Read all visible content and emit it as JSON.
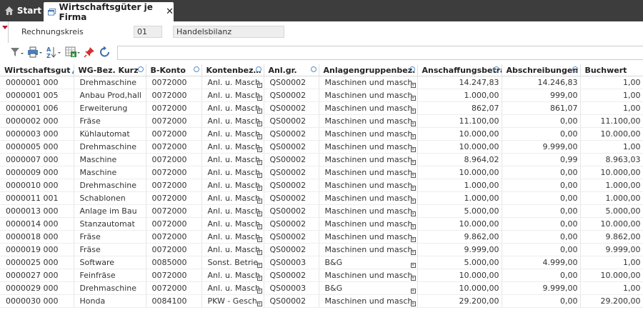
{
  "tabs": {
    "start": "Start",
    "active": "Wirtschaftsgüter je Firma",
    "close": "✕"
  },
  "filters": {
    "rechnungskreis_label": "Rechnungskreis",
    "rechnungskreis_value": "01",
    "bilanz_value": "Handelsbilanz"
  },
  "search": {
    "placeholder": ""
  },
  "columns": [
    "Wirtschaftsgut",
    "WG-Bez. Kurz",
    "B-Konto",
    "Kontenbez…",
    "Anl.gr.",
    "Anlagengruppenbez.",
    "Anschaffungsbetrag",
    "Abschreibungen",
    "Buchwert"
  ],
  "rows": [
    [
      "0000001 000",
      "Drehmaschine",
      "0072000",
      "Anl. u. Masch",
      "QS00002",
      "Maschinen und masch.",
      "14.247,83",
      "14.246,83",
      "1,00"
    ],
    [
      "0000001 005",
      "Anbau Prod,hall",
      "0072000",
      "Anl. u. Masch",
      "QS00002",
      "Maschinen und masch.",
      "1.000,00",
      "999,00",
      "1,00"
    ],
    [
      "0000001 006",
      "Erweiterung",
      "0072000",
      "Anl. u. Masch",
      "QS00002",
      "Maschinen und masch.",
      "862,07",
      "861,07",
      "1,00"
    ],
    [
      "0000002 000",
      "Fräse",
      "0072000",
      "Anl. u. Masch",
      "QS00002",
      "Maschinen und masch.",
      "11.100,00",
      "0,00",
      "11.100,00"
    ],
    [
      "0000003 000",
      "Kühlautomat",
      "0072000",
      "Anl. u. Masch",
      "QS00002",
      "Maschinen und masch.",
      "10.000,00",
      "0,00",
      "10.000,00"
    ],
    [
      "0000005 000",
      "Drehmaschine",
      "0072000",
      "Anl. u. Masch",
      "QS00002",
      "Maschinen und masch.",
      "10.000,00",
      "9.999,00",
      "1,00"
    ],
    [
      "0000007 000",
      "Maschine",
      "0072000",
      "Anl. u. Masch",
      "QS00002",
      "Maschinen und masch.",
      "8.964,02",
      "0,99",
      "8.963,03"
    ],
    [
      "0000009 000",
      "Maschine",
      "0072000",
      "Anl. u. Masch",
      "QS00002",
      "Maschinen und masch.",
      "10.000,00",
      "0,00",
      "10.000,00"
    ],
    [
      "0000010 000",
      "Drehmaschine",
      "0072000",
      "Anl. u. Masch",
      "QS00002",
      "Maschinen und masch.",
      "1.000,00",
      "0,00",
      "1.000,00"
    ],
    [
      "0000011 001",
      "Schablonen",
      "0072000",
      "Anl. u. Masch",
      "QS00002",
      "Maschinen und masch.",
      "1.000,00",
      "0,00",
      "1.000,00"
    ],
    [
      "0000013 000",
      "Anlage im Bau",
      "0072000",
      "Anl. u. Masch",
      "QS00002",
      "Maschinen und masch.",
      "5.000,00",
      "0,00",
      "5.000,00"
    ],
    [
      "0000014 000",
      "Stanzautomat",
      "0072000",
      "Anl. u. Masch",
      "QS00002",
      "Maschinen und masch.",
      "10.000,00",
      "0,00",
      "10.000,00"
    ],
    [
      "0000018 000",
      "Fräse",
      "0072000",
      "Anl. u. Masch",
      "QS00002",
      "Maschinen und masch.",
      "9.862,00",
      "0,00",
      "9.862,00"
    ],
    [
      "0000019 000",
      "Fräse",
      "0072000",
      "Anl. u. Masch",
      "QS00002",
      "Maschinen und masch.",
      "9.999,00",
      "0,00",
      "9.999,00"
    ],
    [
      "0000025 000",
      "Software",
      "0085000",
      "Sonst. Betrie",
      "QS00003",
      "B&G",
      "5.000,00",
      "4.999,00",
      "1,00"
    ],
    [
      "0000027 000",
      "Feinfräse",
      "0072000",
      "Anl. u. Masch",
      "QS00002",
      "Maschinen und masch.",
      "10.000,00",
      "0,00",
      "10.000,00"
    ],
    [
      "0000029 000",
      "Drehmaschine",
      "0072000",
      "Anl. u. Masch",
      "QS00003",
      "B&G",
      "10.000,00",
      "9.999,00",
      "1,00"
    ],
    [
      "0000030 000",
      "Honda",
      "0084100",
      "PKW - Gesch",
      "QS00002",
      "Maschinen und masch.",
      "29.200,00",
      "0,00",
      "29.200,00"
    ]
  ],
  "icons": {
    "home": "home-icon",
    "window": "window-icon",
    "filter": "filter-icon",
    "print": "print-icon",
    "sort": "sort-az-icon",
    "export": "excel-export-icon",
    "pin": "pin-icon",
    "refresh": "refresh-icon"
  },
  "colors": {
    "topbar": "#3d3d3d",
    "accent": "#3a7bc8",
    "marker": "#c0102a"
  }
}
